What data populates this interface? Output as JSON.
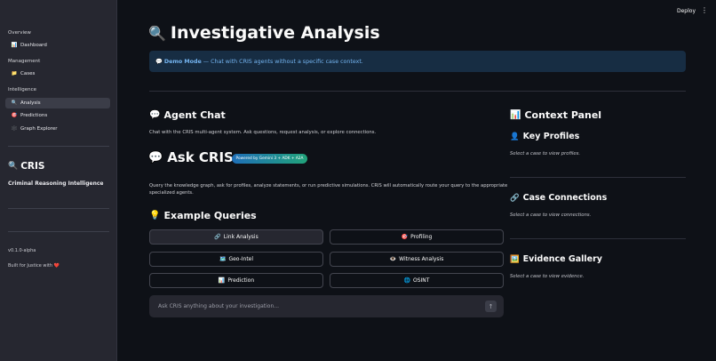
{
  "sidebar": {
    "sections": {
      "overview": "Overview",
      "management": "Management",
      "intelligence": "Intelligence"
    },
    "items": [
      {
        "label": "Dashboard",
        "icon": "📊"
      },
      {
        "label": "Cases",
        "icon": "📁"
      },
      {
        "label": "Analysis",
        "icon": "🔍"
      },
      {
        "label": "Predictions",
        "icon": "🎯"
      },
      {
        "label": "Graph Explorer",
        "icon": "🕸️"
      }
    ],
    "brand": {
      "icon": "🔍",
      "name": "CRIS",
      "subtitle": "Criminal Reasoning Intelligence"
    },
    "version": "v0.1.0-alpha",
    "built": "Built for Justice with ❤️"
  },
  "header": {
    "deploy": "Deploy",
    "menu": "⋮"
  },
  "main": {
    "title_icon": "🔍",
    "title": "Investigative Analysis",
    "demo": {
      "icon": "💬",
      "label": "Demo Mode",
      "text": "— Chat with CRIS agents without a specific case context."
    },
    "agent_chat": {
      "icon": "💬",
      "title": "Agent Chat",
      "caption": "Chat with the CRIS multi-agent system. Ask questions, request analysis, or explore connections."
    },
    "ask": {
      "icon": "💬",
      "title": "Ask CRIS",
      "badge": "Powered by Gemini 3 + ADK + A2A",
      "description": "Query the knowledge graph, ask for profiles, analyze statements, or run predictive simulations. CRIS will automatically route your query to the appropriate specialized agents."
    },
    "examples": {
      "icon": "💡",
      "title": "Example Queries",
      "buttons": [
        {
          "icon": "🔗",
          "label": "Link Analysis"
        },
        {
          "icon": "🎯",
          "label": "Profiling"
        },
        {
          "icon": "🗺️",
          "label": "Geo-Intel"
        },
        {
          "icon": "👁️",
          "label": "Witness Analysis"
        },
        {
          "icon": "📊",
          "label": "Prediction"
        },
        {
          "icon": "🌐",
          "label": "OSINT"
        }
      ]
    },
    "chat_input": {
      "placeholder": "Ask CRIS anything about your investigation...",
      "send": "↑"
    }
  },
  "context": {
    "title_icon": "📊",
    "title": "Context Panel",
    "key_profiles": {
      "icon": "👤",
      "title": "Key Profiles",
      "empty": "Select a case to view profiles."
    },
    "connections": {
      "icon": "🔗",
      "title": "Case Connections",
      "empty": "Select a case to view connections."
    },
    "evidence": {
      "icon": "🖼️",
      "title": "Evidence Gallery",
      "empty": "Select a case to view evidence."
    }
  },
  "colors": {
    "background": "#0e1117",
    "sidebar": "#262730",
    "demo_bg": "#172d43",
    "demo_text": "#74b4f0"
  }
}
